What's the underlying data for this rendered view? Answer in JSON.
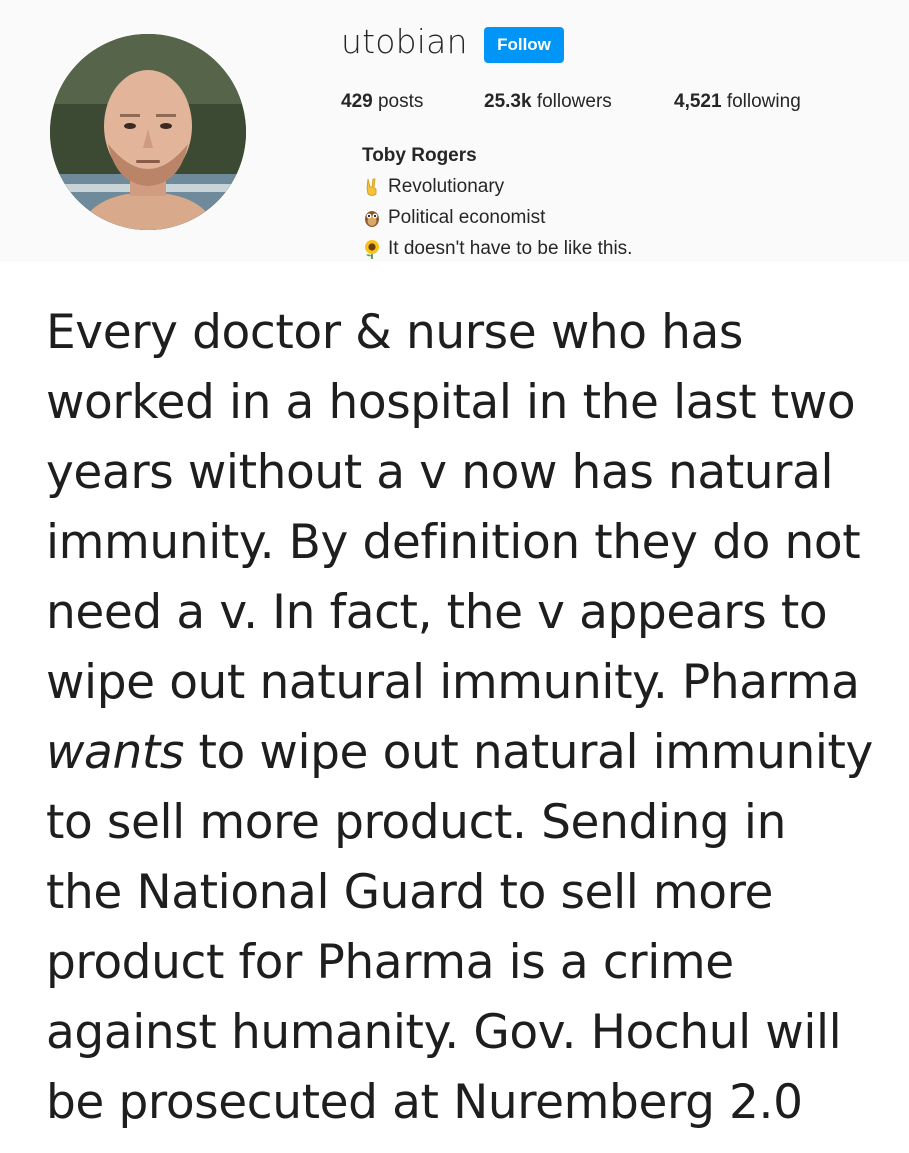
{
  "profile": {
    "username": "utobian",
    "follow_label": "Follow",
    "stats": {
      "posts_count": "429",
      "posts_label": " posts",
      "followers_count": "25.3k",
      "followers_label": " followers",
      "following_count": "4,521",
      "following_label": " following"
    },
    "full_name": "Toby Rogers",
    "bio": [
      {
        "icon": "victory-hand-icon",
        "text": "Revolutionary"
      },
      {
        "icon": "owl-icon",
        "text": "Political economist"
      },
      {
        "icon": "sunflower-icon",
        "text": "It doesn't have to be like this."
      }
    ]
  },
  "post": {
    "lines": [
      {
        "text": "Every doctor & nurse who has"
      },
      {
        "text": "worked in a hospital in the last two"
      },
      {
        "text": "years without a v now has natural"
      },
      {
        "text": "immunity. By definition they do not"
      },
      {
        "text": "need a v. In fact, the v appears to"
      },
      {
        "text": "wipe out natural immunity. Pharma"
      },
      {
        "italic": "wants",
        "text": " to wipe out natural immunity"
      },
      {
        "text": "to sell more product. Sending in"
      },
      {
        "text": "the National Guard to sell more"
      },
      {
        "text": "product for Pharma is a crime"
      },
      {
        "text": "against humanity. Gov. Hochul will"
      },
      {
        "text": "be prosecuted at Nuremberg 2.0"
      }
    ]
  },
  "colors": {
    "follow_button": "#0095f6",
    "header_background": "#fafafa",
    "text": "#262626"
  }
}
